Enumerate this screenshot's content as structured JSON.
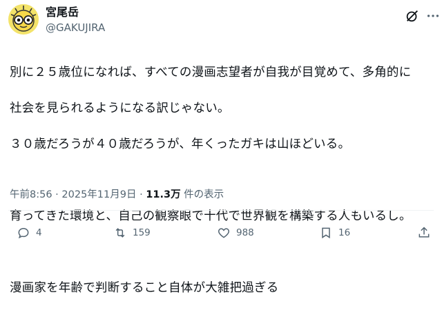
{
  "author": {
    "name": "宮尾岳",
    "handle": "@GAKUJIRA"
  },
  "post": {
    "lines": [
      "別に２５歳位になれば、すべての漫画志望者が自我が目覚めて、多角的に",
      "社会を見られるようになる訳じゃない。",
      "３０歳だろうが４０歳だろうが、年くったガキは山ほどいる。",
      "",
      "育ってきた環境と、自己の観察眼で十代で世界観を構築する人もいるし。",
      "",
      "漫画家を年齢で判断すること自体が大雑把過ぎる"
    ]
  },
  "meta": {
    "time": "午前8:56",
    "sep1": " · ",
    "date": "2025年11月9日",
    "sep2": " · ",
    "views_count": "11.3万",
    "views_label": " 件の表示"
  },
  "actions": {
    "replies": "4",
    "retweets": "159",
    "likes": "988",
    "bookmarks": "16"
  },
  "icons": {
    "grok": "grok-icon",
    "more": "more-icon",
    "reply": "reply-icon",
    "retweet": "retweet-icon",
    "like": "heart-icon",
    "bookmark": "bookmark-icon",
    "share": "share-icon"
  },
  "colors": {
    "text": "#0f1419",
    "secondary": "#536471",
    "avatar_bg": "#f3e36a"
  }
}
